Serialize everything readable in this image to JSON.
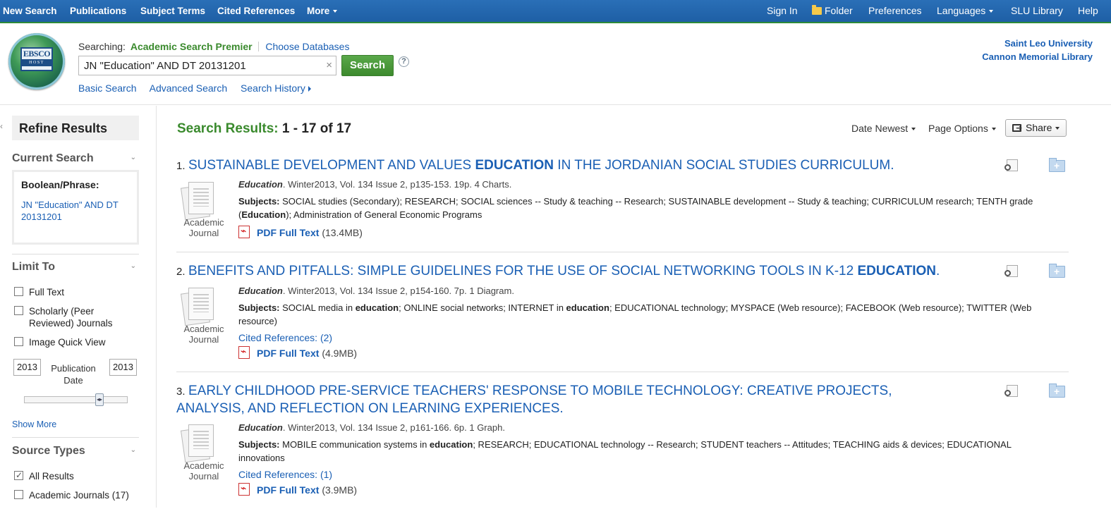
{
  "topnav": {
    "left": [
      "New Search",
      "Publications",
      "Subject Terms",
      "Cited References",
      "More"
    ],
    "right": [
      "Sign In",
      "Folder",
      "Preferences",
      "Languages",
      "SLU Library",
      "Help"
    ]
  },
  "header": {
    "logo_text": "EBSCO",
    "logo_sub": "HOST",
    "searching_label": "Searching:",
    "database": "Academic Search Premier",
    "choose_databases": "Choose Databases",
    "search_value": "JN \"Education\" AND DT 20131201",
    "clear": "×",
    "search_button": "Search",
    "help": "?",
    "links": [
      "Basic Search",
      "Advanced Search",
      "Search History"
    ],
    "institution_line1": "Saint Leo University",
    "institution_line2": "Cannon Memorial Library"
  },
  "sidebar": {
    "collapse": "‹",
    "refine_title": "Refine Results",
    "current_search_title": "Current Search",
    "boolean_label": "Boolean/Phrase:",
    "boolean_value": "JN \"Education\" AND DT 20131201",
    "limit_to_title": "Limit To",
    "limits": [
      {
        "label": "Full Text",
        "checked": false
      },
      {
        "label": "Scholarly (Peer Reviewed) Journals",
        "checked": false
      },
      {
        "label": "Image Quick View",
        "checked": false
      }
    ],
    "year_from": "2013",
    "year_to": "2013",
    "pub_date_label": "Publication Date",
    "slider_handle": "◂▸",
    "show_more": "Show More",
    "source_types_title": "Source Types",
    "source_types": [
      {
        "label": "All Results",
        "checked": true
      },
      {
        "label": "Academic Journals (17)",
        "checked": false
      }
    ]
  },
  "main": {
    "results_label": "Search Results:",
    "results_range": "1 - 17 of 17",
    "sort": "Date Newest",
    "page_options": "Page Options",
    "share": "Share",
    "results": [
      {
        "num": "1.",
        "title_pre": "SUSTAINABLE DEVELOPMENT AND VALUES ",
        "title_bold": "EDUCATION",
        "title_post": " IN THE JORDANIAN SOCIAL STUDIES CURRICULUM.",
        "type_line1": "Academic",
        "type_line2": "Journal",
        "source_journal": "Education",
        "source_rest": ". Winter2013, Vol. 134 Issue 2, p135-153. 19p. 4 Charts.",
        "subjects_label": "Subjects:",
        "subjects_html": [
          " SOCIAL studies (Secondary); RESEARCH; SOCIAL sciences -- Study & teaching -- Research; SUSTAINABLE development -- Study & teaching; CURRICULUM research; TENTH grade (",
          "Education",
          "); Administration of General Economic Programs"
        ],
        "cited": "",
        "pdf_label": "PDF Full Text",
        "pdf_size": "(13.4MB)"
      },
      {
        "num": "2.",
        "title_pre": "BENEFITS AND PITFALLS: SIMPLE GUIDELINES FOR THE USE OF SOCIAL NETWORKING TOOLS IN K-12 ",
        "title_bold": "EDUCATION",
        "title_post": ".",
        "type_line1": "Academic",
        "type_line2": "Journal",
        "source_journal": "Education",
        "source_rest": ". Winter2013, Vol. 134 Issue 2, p154-160. 7p. 1 Diagram.",
        "subjects_label": "Subjects:",
        "subjects_html": [
          " SOCIAL media in ",
          "education",
          "; ONLINE social networks; INTERNET in ",
          "education",
          "; EDUCATIONAL technology; MYSPACE (Web resource); FACEBOOK (Web resource); TWITTER (Web resource)"
        ],
        "cited": "Cited References: (2)",
        "pdf_label": "PDF Full Text",
        "pdf_size": "(4.9MB)"
      },
      {
        "num": "3.",
        "title_pre": "EARLY CHILDHOOD PRE-SERVICE TEACHERS' RESPONSE TO MOBILE TECHNOLOGY: CREATIVE PROJECTS, ANALYSIS, AND REFLECTION ON LEARNING EXPERIENCES.",
        "title_bold": "",
        "title_post": "",
        "type_line1": "Academic",
        "type_line2": "Journal",
        "source_journal": "Education",
        "source_rest": ". Winter2013, Vol. 134 Issue 2, p161-166. 6p. 1 Graph.",
        "subjects_label": "Subjects:",
        "subjects_html": [
          " MOBILE communication systems in ",
          "education",
          "; RESEARCH; EDUCATIONAL technology -- Research; STUDENT teachers -- Attitudes; TEACHING aids & devices; EDUCATIONAL innovations"
        ],
        "cited": "Cited References: (1)",
        "pdf_label": "PDF Full Text",
        "pdf_size": "(3.9MB)"
      }
    ]
  }
}
